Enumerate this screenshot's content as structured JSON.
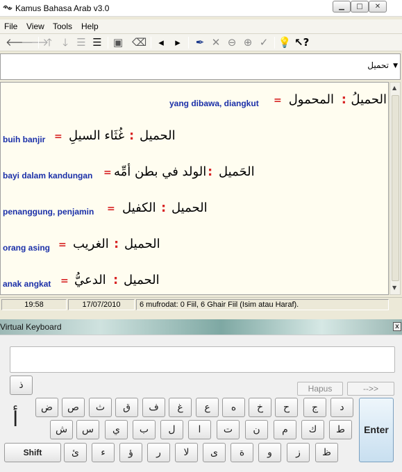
{
  "window": {
    "title": "Kamus Bahasa Arab v3.0"
  },
  "menu": [
    "File",
    "View",
    "Tools",
    "Help"
  ],
  "toolbar": {
    "icons": [
      "back-arrow-icon",
      "forward-arrow-icon",
      "up-arrow-icon",
      "down-arrow-icon",
      "lines-icon",
      "lines-bold-icon",
      "properties-icon",
      "eraser-icon",
      "left-triangle-icon",
      "right-triangle-icon",
      "pin-icon",
      "pin-cross-icon",
      "pin-minus-icon",
      "pin-plus-icon",
      "pin-check-icon",
      "help-bulb-icon",
      "whats-this-icon"
    ]
  },
  "word_select": {
    "value": "تحميل"
  },
  "entries": [
    {
      "arabic_right": "الحميلُ",
      "arabic_left": "المحمول",
      "translation": "yang dibawa, diangkut"
    },
    {
      "arabic_right": "الحميل",
      "arabic_left": "غُثَاء السيلِ",
      "translation": "buih banjir"
    },
    {
      "arabic_right": "الحَميل",
      "arabic_left": "الولد في بطن أمِّه",
      "translation": "bayi dalam kandungan"
    },
    {
      "arabic_right": "الحميل",
      "arabic_left": "الكفيل",
      "translation": "penanggung, penjamin"
    },
    {
      "arabic_right": "الحميل",
      "arabic_left": "الغريب",
      "translation": "orang asing"
    },
    {
      "arabic_right": "الحميل",
      "arabic_left": "الدعيُّ",
      "translation": "anak angkat"
    }
  ],
  "separators": {
    "colon": ":",
    "equals": "="
  },
  "status": {
    "time": "19:58",
    "date": "17/07/2010",
    "info": "6 mufrodat: 0 Fiil, 6 Ghair Fiil (Isim atau Haraf)."
  },
  "keyboard": {
    "title": "Virtual Keyboard",
    "close": "x",
    "hapus": "Hapus",
    "next": "-->>",
    "top_key": "ذ",
    "alif_indicator": "أ",
    "row1": [
      "ض",
      "ص",
      "ث",
      "ق",
      "ف",
      "غ",
      "ع",
      "ه",
      "خ",
      "ح",
      "ج",
      "د"
    ],
    "row2": [
      "ش",
      "س",
      "ي",
      "ب",
      "ل",
      "ا",
      "ت",
      "ن",
      "م",
      "ك",
      "ط"
    ],
    "row3": [
      "ئ",
      "ء",
      "ؤ",
      "ر",
      "لا",
      "ى",
      "ة",
      "و",
      "ز",
      "ظ"
    ],
    "shift": "Shift",
    "enter": "Enter"
  }
}
